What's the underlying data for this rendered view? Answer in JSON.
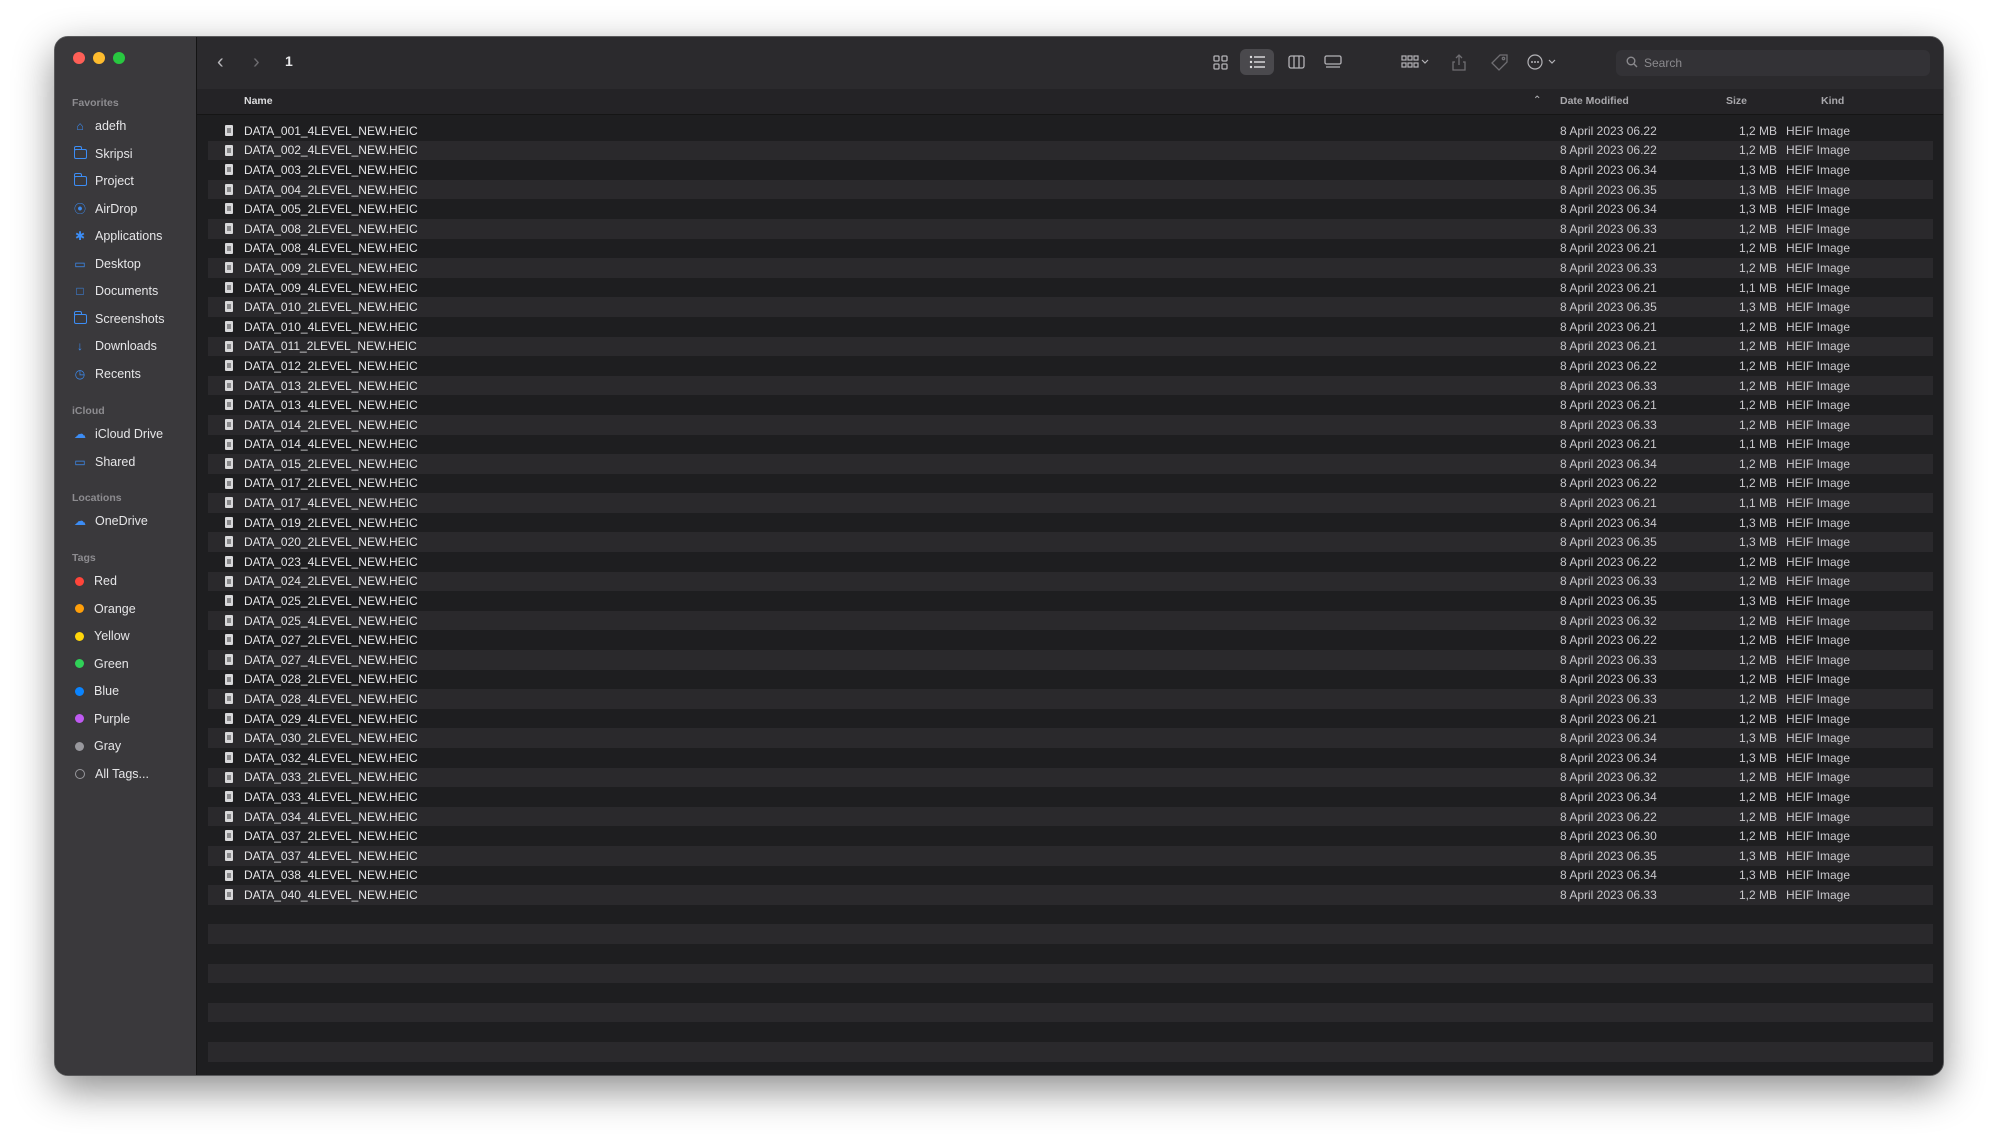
{
  "window": {
    "title": "1"
  },
  "sidebar": {
    "sections": [
      {
        "label": "Favorites",
        "items": [
          {
            "label": "adefh",
            "icon": "home-icon"
          },
          {
            "label": "Skripsi",
            "icon": "folder-icon"
          },
          {
            "label": "Project",
            "icon": "folder-icon"
          },
          {
            "label": "AirDrop",
            "icon": "airdrop-icon"
          },
          {
            "label": "Applications",
            "icon": "applications-icon"
          },
          {
            "label": "Desktop",
            "icon": "desktop-icon"
          },
          {
            "label": "Documents",
            "icon": "document-icon"
          },
          {
            "label": "Screenshots",
            "icon": "folder-icon"
          },
          {
            "label": "Downloads",
            "icon": "download-icon"
          },
          {
            "label": "Recents",
            "icon": "clock-icon"
          }
        ]
      },
      {
        "label": "iCloud",
        "items": [
          {
            "label": "iCloud Drive",
            "icon": "cloud-icon"
          },
          {
            "label": "Shared",
            "icon": "shared-folder-icon"
          }
        ]
      },
      {
        "label": "Locations",
        "items": [
          {
            "label": "OneDrive",
            "icon": "cloud-icon"
          }
        ]
      },
      {
        "label": "Tags",
        "items": [
          {
            "label": "Red",
            "color": "#ff453a"
          },
          {
            "label": "Orange",
            "color": "#ff9f0a"
          },
          {
            "label": "Yellow",
            "color": "#ffd60a"
          },
          {
            "label": "Green",
            "color": "#30d158"
          },
          {
            "label": "Blue",
            "color": "#0a84ff"
          },
          {
            "label": "Purple",
            "color": "#bf5af2"
          },
          {
            "label": "Gray",
            "color": "#98989d"
          },
          {
            "label": "All Tags...",
            "color": "none"
          }
        ]
      }
    ]
  },
  "toolbar": {
    "back_icon": "chevron-left-icon",
    "forward_icon": "chevron-right-icon",
    "search_placeholder": "Search"
  },
  "columns": {
    "name": "Name",
    "date": "Date Modified",
    "size": "Size",
    "kind": "Kind"
  },
  "files": [
    {
      "name": "DATA_001_4LEVEL_NEW.HEIC",
      "date": "8 April 2023 06.22",
      "size": "1,2 MB",
      "kind": "HEIF Image"
    },
    {
      "name": "DATA_002_4LEVEL_NEW.HEIC",
      "date": "8 April 2023 06.22",
      "size": "1,2 MB",
      "kind": "HEIF Image"
    },
    {
      "name": "DATA_003_2LEVEL_NEW.HEIC",
      "date": "8 April 2023 06.34",
      "size": "1,3 MB",
      "kind": "HEIF Image"
    },
    {
      "name": "DATA_004_2LEVEL_NEW.HEIC",
      "date": "8 April 2023 06.35",
      "size": "1,3 MB",
      "kind": "HEIF Image"
    },
    {
      "name": "DATA_005_2LEVEL_NEW.HEIC",
      "date": "8 April 2023 06.34",
      "size": "1,3 MB",
      "kind": "HEIF Image"
    },
    {
      "name": "DATA_008_2LEVEL_NEW.HEIC",
      "date": "8 April 2023 06.33",
      "size": "1,2 MB",
      "kind": "HEIF Image"
    },
    {
      "name": "DATA_008_4LEVEL_NEW.HEIC",
      "date": "8 April 2023 06.21",
      "size": "1,2 MB",
      "kind": "HEIF Image"
    },
    {
      "name": "DATA_009_2LEVEL_NEW.HEIC",
      "date": "8 April 2023 06.33",
      "size": "1,2 MB",
      "kind": "HEIF Image"
    },
    {
      "name": "DATA_009_4LEVEL_NEW.HEIC",
      "date": "8 April 2023 06.21",
      "size": "1,1 MB",
      "kind": "HEIF Image"
    },
    {
      "name": "DATA_010_2LEVEL_NEW.HEIC",
      "date": "8 April 2023 06.35",
      "size": "1,3 MB",
      "kind": "HEIF Image"
    },
    {
      "name": "DATA_010_4LEVEL_NEW.HEIC",
      "date": "8 April 2023 06.21",
      "size": "1,2 MB",
      "kind": "HEIF Image"
    },
    {
      "name": "DATA_011_2LEVEL_NEW.HEIC",
      "date": "8 April 2023 06.21",
      "size": "1,2 MB",
      "kind": "HEIF Image"
    },
    {
      "name": "DATA_012_2LEVEL_NEW.HEIC",
      "date": "8 April 2023 06.22",
      "size": "1,2 MB",
      "kind": "HEIF Image"
    },
    {
      "name": "DATA_013_2LEVEL_NEW.HEIC",
      "date": "8 April 2023 06.33",
      "size": "1,2 MB",
      "kind": "HEIF Image"
    },
    {
      "name": "DATA_013_4LEVEL_NEW.HEIC",
      "date": "8 April 2023 06.21",
      "size": "1,2 MB",
      "kind": "HEIF Image"
    },
    {
      "name": "DATA_014_2LEVEL_NEW.HEIC",
      "date": "8 April 2023 06.33",
      "size": "1,2 MB",
      "kind": "HEIF Image"
    },
    {
      "name": "DATA_014_4LEVEL_NEW.HEIC",
      "date": "8 April 2023 06.21",
      "size": "1,1 MB",
      "kind": "HEIF Image"
    },
    {
      "name": "DATA_015_2LEVEL_NEW.HEIC",
      "date": "8 April 2023 06.34",
      "size": "1,2 MB",
      "kind": "HEIF Image"
    },
    {
      "name": "DATA_017_2LEVEL_NEW.HEIC",
      "date": "8 April 2023 06.22",
      "size": "1,2 MB",
      "kind": "HEIF Image"
    },
    {
      "name": "DATA_017_4LEVEL_NEW.HEIC",
      "date": "8 April 2023 06.21",
      "size": "1,1 MB",
      "kind": "HEIF Image"
    },
    {
      "name": "DATA_019_2LEVEL_NEW.HEIC",
      "date": "8 April 2023 06.34",
      "size": "1,3 MB",
      "kind": "HEIF Image"
    },
    {
      "name": "DATA_020_2LEVEL_NEW.HEIC",
      "date": "8 April 2023 06.35",
      "size": "1,3 MB",
      "kind": "HEIF Image"
    },
    {
      "name": "DATA_023_4LEVEL_NEW.HEIC",
      "date": "8 April 2023 06.22",
      "size": "1,2 MB",
      "kind": "HEIF Image"
    },
    {
      "name": "DATA_024_2LEVEL_NEW.HEIC",
      "date": "8 April 2023 06.33",
      "size": "1,2 MB",
      "kind": "HEIF Image"
    },
    {
      "name": "DATA_025_2LEVEL_NEW.HEIC",
      "date": "8 April 2023 06.35",
      "size": "1,3 MB",
      "kind": "HEIF Image"
    },
    {
      "name": "DATA_025_4LEVEL_NEW.HEIC",
      "date": "8 April 2023 06.32",
      "size": "1,2 MB",
      "kind": "HEIF Image"
    },
    {
      "name": "DATA_027_2LEVEL_NEW.HEIC",
      "date": "8 April 2023 06.22",
      "size": "1,2 MB",
      "kind": "HEIF Image"
    },
    {
      "name": "DATA_027_4LEVEL_NEW.HEIC",
      "date": "8 April 2023 06.33",
      "size": "1,2 MB",
      "kind": "HEIF Image"
    },
    {
      "name": "DATA_028_2LEVEL_NEW.HEIC",
      "date": "8 April 2023 06.33",
      "size": "1,2 MB",
      "kind": "HEIF Image"
    },
    {
      "name": "DATA_028_4LEVEL_NEW.HEIC",
      "date": "8 April 2023 06.33",
      "size": "1,2 MB",
      "kind": "HEIF Image"
    },
    {
      "name": "DATA_029_4LEVEL_NEW.HEIC",
      "date": "8 April 2023 06.21",
      "size": "1,2 MB",
      "kind": "HEIF Image"
    },
    {
      "name": "DATA_030_2LEVEL_NEW.HEIC",
      "date": "8 April 2023 06.34",
      "size": "1,3 MB",
      "kind": "HEIF Image"
    },
    {
      "name": "DATA_032_4LEVEL_NEW.HEIC",
      "date": "8 April 2023 06.34",
      "size": "1,3 MB",
      "kind": "HEIF Image"
    },
    {
      "name": "DATA_033_2LEVEL_NEW.HEIC",
      "date": "8 April 2023 06.32",
      "size": "1,2 MB",
      "kind": "HEIF Image"
    },
    {
      "name": "DATA_033_4LEVEL_NEW.HEIC",
      "date": "8 April 2023 06.34",
      "size": "1,2 MB",
      "kind": "HEIF Image"
    },
    {
      "name": "DATA_034_4LEVEL_NEW.HEIC",
      "date": "8 April 2023 06.22",
      "size": "1,2 MB",
      "kind": "HEIF Image"
    },
    {
      "name": "DATA_037_2LEVEL_NEW.HEIC",
      "date": "8 April 2023 06.30",
      "size": "1,2 MB",
      "kind": "HEIF Image"
    },
    {
      "name": "DATA_037_4LEVEL_NEW.HEIC",
      "date": "8 April 2023 06.35",
      "size": "1,3 MB",
      "kind": "HEIF Image"
    },
    {
      "name": "DATA_038_4LEVEL_NEW.HEIC",
      "date": "8 April 2023 06.34",
      "size": "1,3 MB",
      "kind": "HEIF Image"
    },
    {
      "name": "DATA_040_4LEVEL_NEW.HEIC",
      "date": "8 April 2023 06.33",
      "size": "1,2 MB",
      "kind": "HEIF Image"
    }
  ]
}
